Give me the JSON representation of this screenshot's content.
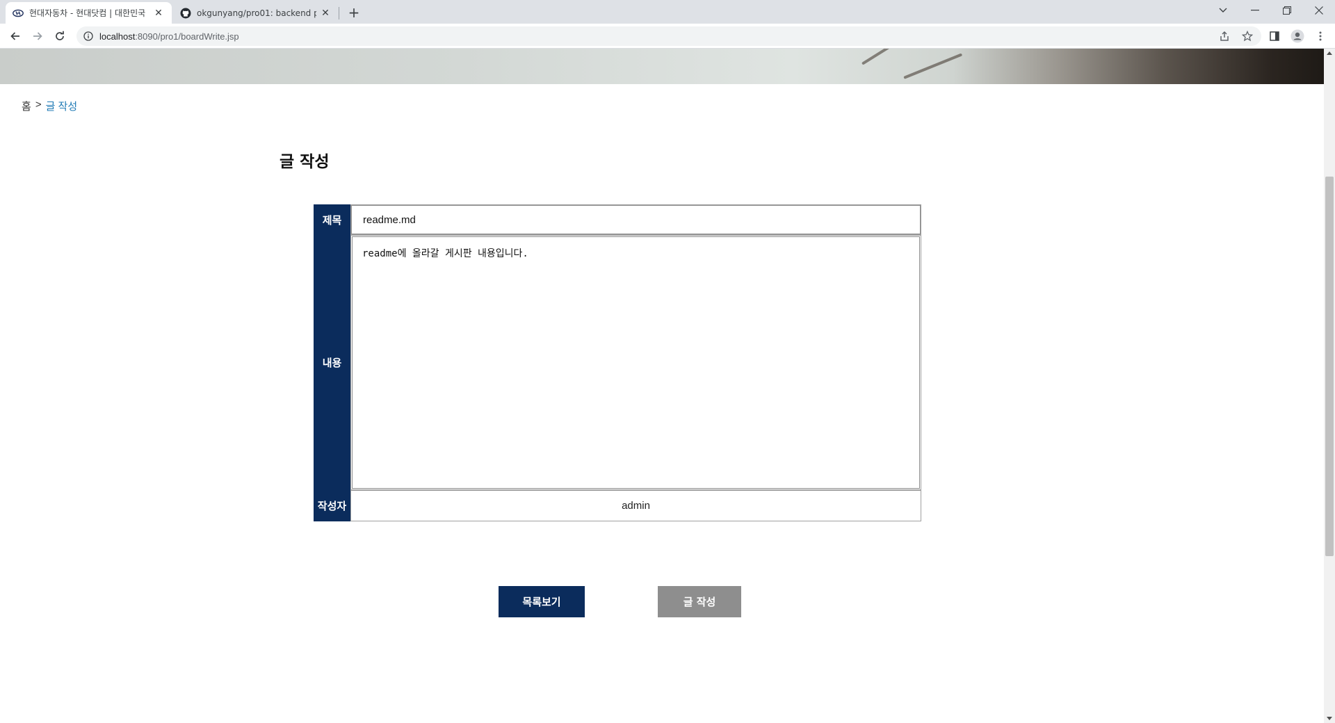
{
  "browser": {
    "tabs": [
      {
        "title": "현대자동차 - 현대닷컴 | 대한민국",
        "active": true
      },
      {
        "title": "okgunyang/pro01: backend project",
        "active": false
      }
    ],
    "url_host": "localhost",
    "url_path": ":8090/pro1/boardWrite.jsp"
  },
  "breadcrumb": {
    "home": "홈",
    "separator": ">",
    "current": "글 작성"
  },
  "page_title": "글 작성",
  "form": {
    "title_label": "제목",
    "title_value": "readme.md",
    "content_label": "내용",
    "content_value": "readme에 올라갈 게시판 내용입니다.",
    "writer_label": "작성자",
    "writer_value": "admin"
  },
  "buttons": {
    "list_label": "목록보기",
    "write_label": "글 작성"
  },
  "colors": {
    "navy": "#0b2c5c",
    "gray_button": "#8e8e8e",
    "breadcrumb_current": "#1f7ab5"
  }
}
